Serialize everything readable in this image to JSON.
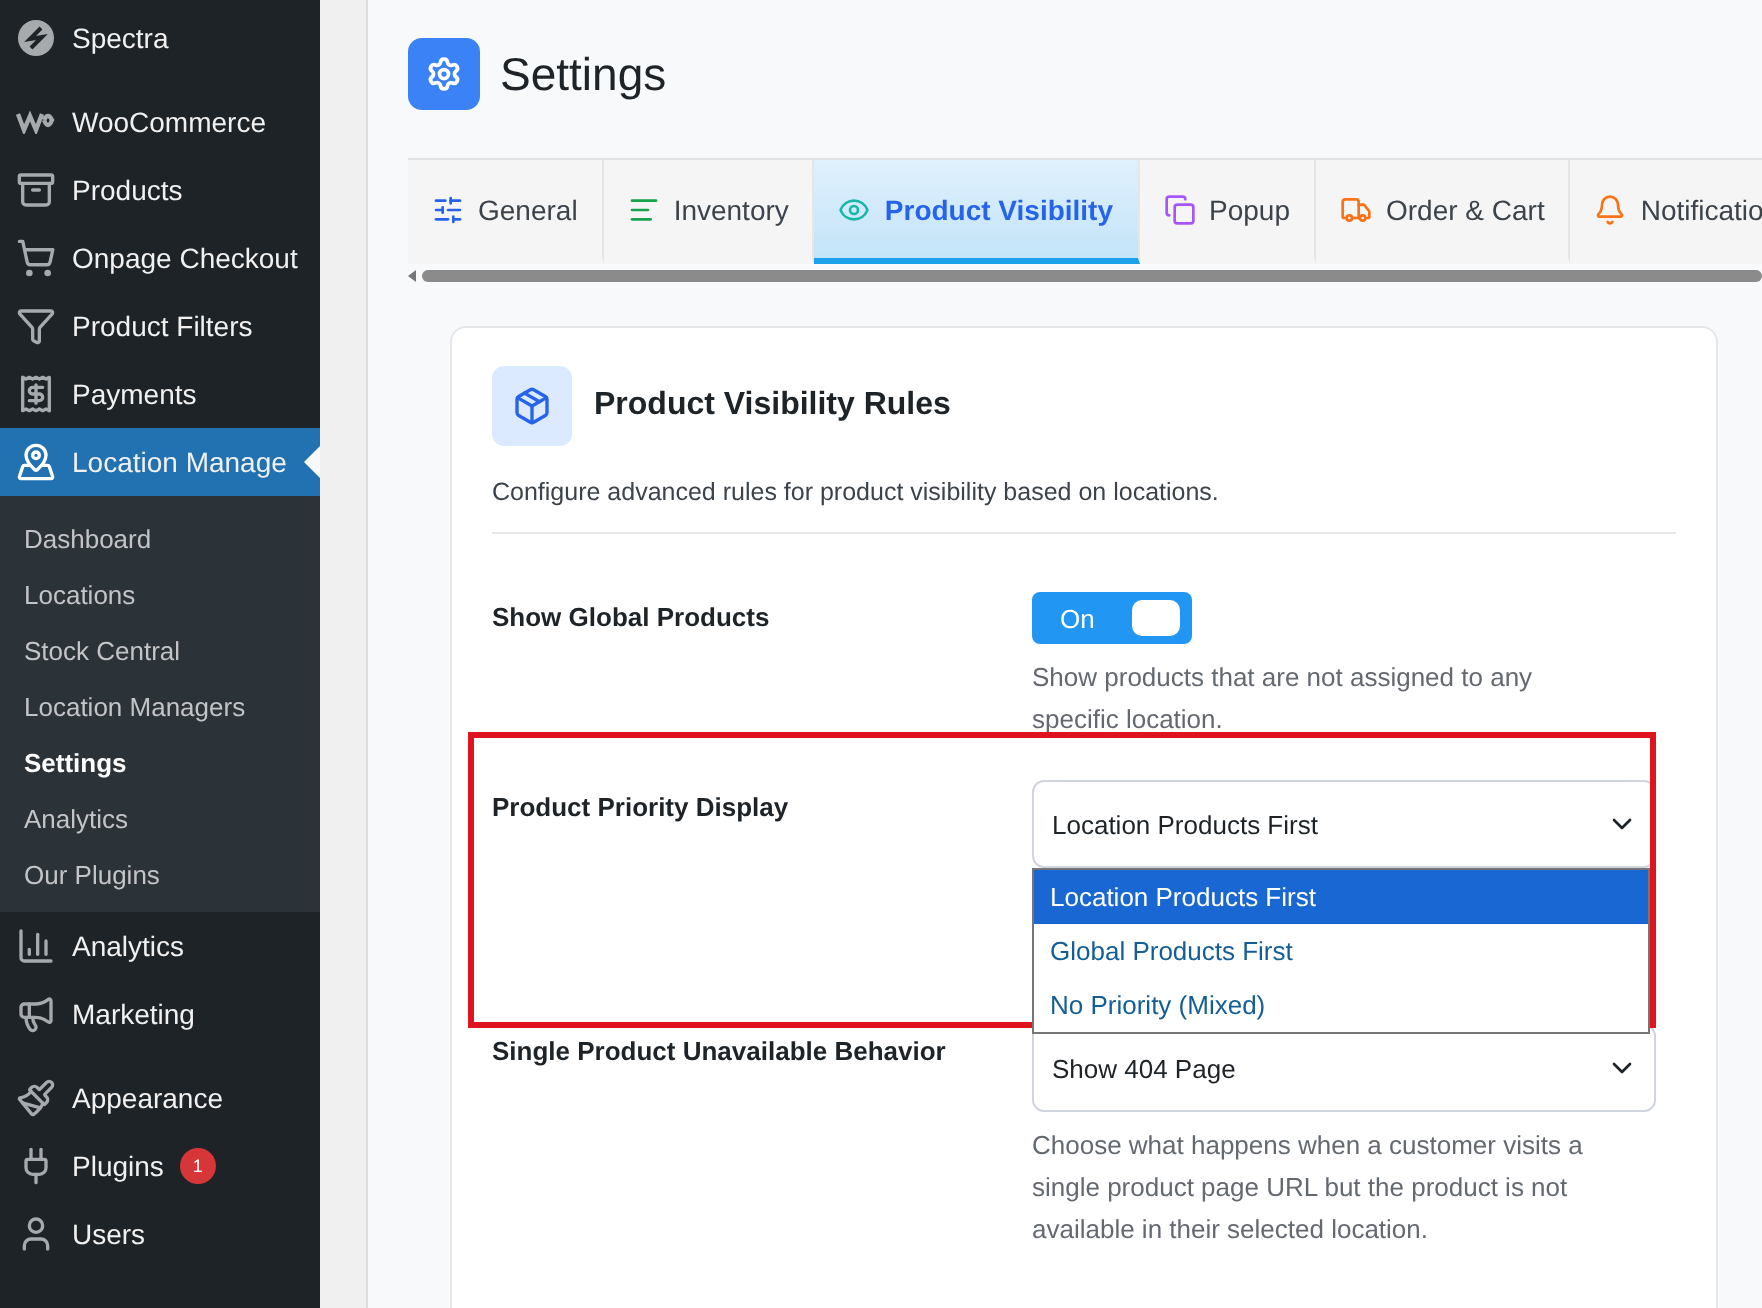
{
  "sidebar": {
    "items": [
      {
        "label": "Spectra",
        "selected": false
      },
      {
        "label": "WooCommerce",
        "selected": false
      },
      {
        "label": "Products",
        "selected": false
      },
      {
        "label": "Onpage Checkout",
        "selected": false
      },
      {
        "label": "Product Filters",
        "selected": false
      },
      {
        "label": "Payments",
        "selected": false
      },
      {
        "label": "Location Manage",
        "selected": true,
        "children": [
          {
            "label": "Dashboard",
            "selected": false
          },
          {
            "label": "Locations",
            "selected": false
          },
          {
            "label": "Stock Central",
            "selected": false
          },
          {
            "label": "Location Managers",
            "selected": false
          },
          {
            "label": "Settings",
            "selected": true
          },
          {
            "label": "Analytics",
            "selected": false
          },
          {
            "label": "Our Plugins",
            "selected": false
          }
        ]
      },
      {
        "label": "Analytics",
        "selected": false
      },
      {
        "label": "Marketing",
        "selected": false
      },
      {
        "label": "Appearance",
        "selected": false
      },
      {
        "label": "Plugins",
        "selected": false,
        "badge": "1"
      },
      {
        "label": "Users",
        "selected": false
      }
    ]
  },
  "page": {
    "title": "Settings"
  },
  "tabs": [
    {
      "label": "General",
      "selected": false
    },
    {
      "label": "Inventory",
      "selected": false
    },
    {
      "label": "Product Visibility",
      "selected": true
    },
    {
      "label": "Popup",
      "selected": false
    },
    {
      "label": "Order & Cart",
      "selected": false
    },
    {
      "label": "Notificatio",
      "selected": false
    }
  ],
  "card": {
    "title": "Product Visibility Rules",
    "description": "Configure advanced rules for product visibility based on locations.",
    "settings": [
      {
        "kind": "toggle",
        "label": "Show Global Products",
        "on": true,
        "state_label": "On",
        "description": "Show products that are not assigned to any specific location."
      },
      {
        "kind": "select",
        "label": "Product Priority Display",
        "value": "Location Products First",
        "expanded": true,
        "options": [
          {
            "label": "Location Products First",
            "selected": true
          },
          {
            "label": "Global Products First",
            "selected": false
          },
          {
            "label": "No Priority (Mixed)",
            "selected": false
          }
        ]
      },
      {
        "kind": "select",
        "label": "Single Product Unavailable Behavior",
        "value": "Show 404 Page",
        "expanded": false,
        "description": "Choose what happens when a customer visits a single product page URL but the product is not available in their selected location."
      }
    ]
  }
}
